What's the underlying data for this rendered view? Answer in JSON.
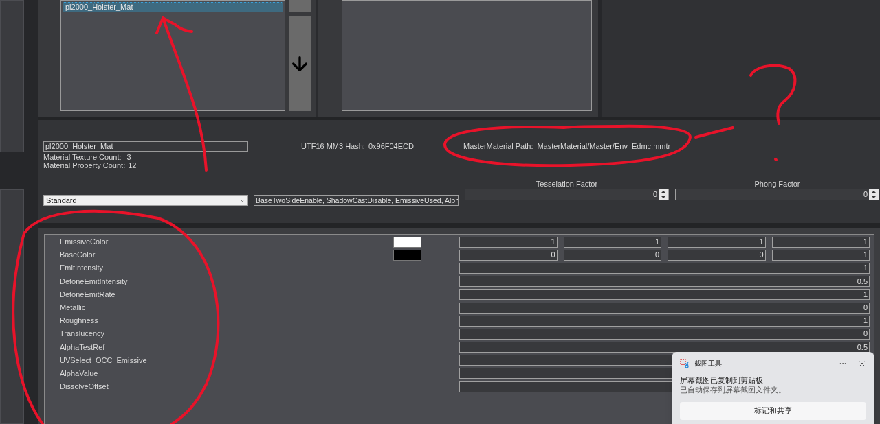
{
  "material_list": {
    "items": [
      {
        "label": "pl2000_Holster_Mat",
        "selected": true
      }
    ]
  },
  "material": {
    "name": "pl2000_Holster_Mat",
    "texture_count_label": "Material Texture Count:",
    "texture_count": "3",
    "property_count_label": "Material Property Count:",
    "property_count": "12",
    "hash_label": "UTF16 MM3 Hash:",
    "hash": "0x96F04ECD",
    "master_path_label": "MasterMaterial Path:",
    "master_path": "MasterMaterial/Master/Env_Edmc.mmtr"
  },
  "shader_type": "Standard",
  "flags": "BaseTwoSideEnable, ShadowCastDisable, EmissiveUsed, Alp",
  "factors": [
    {
      "label": "Tesselation Factor",
      "value": "0"
    },
    {
      "label": "Phong Factor",
      "value": "0"
    }
  ],
  "properties": [
    {
      "name": "EmissiveColor",
      "kind": "color",
      "color": "#ffffff",
      "values": [
        "1",
        "1",
        "1",
        "1"
      ]
    },
    {
      "name": "BaseColor",
      "kind": "color",
      "color": "#000000",
      "values": [
        "0",
        "0",
        "0",
        "1"
      ]
    },
    {
      "name": "EmitIntensity",
      "kind": "scalar",
      "value": "1"
    },
    {
      "name": "DetoneEmitIntensity",
      "kind": "scalar",
      "value": "0.5"
    },
    {
      "name": "DetoneEmitRate",
      "kind": "scalar",
      "value": "1"
    },
    {
      "name": "Metallic",
      "kind": "scalar",
      "value": "0"
    },
    {
      "name": "Roughness",
      "kind": "scalar",
      "value": "1"
    },
    {
      "name": "Translucency",
      "kind": "scalar",
      "value": "0"
    },
    {
      "name": "AlphaTestRef",
      "kind": "scalar",
      "value": "0.5"
    },
    {
      "name": "UVSelect_OCC_Emissive",
      "kind": "scalar"
    },
    {
      "name": "AlphaValue",
      "kind": "scalar"
    },
    {
      "name": "DissolveOffset",
      "kind": "scalar"
    }
  ],
  "notification": {
    "app": "截图工具",
    "title": "屏幕截图已复制到剪贴板",
    "body": "已自动保存到屏幕截图文件夹。",
    "action": "标记和共享"
  }
}
